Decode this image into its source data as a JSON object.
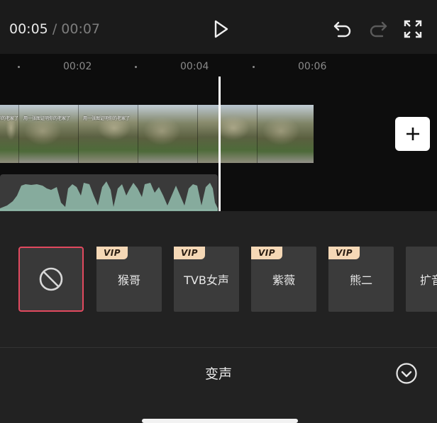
{
  "playback": {
    "current_time": "00:05",
    "separator": "/",
    "total_time": "00:07"
  },
  "timeline": {
    "ticks": [
      "00:02",
      "00:04",
      "00:06"
    ],
    "video_caption": "用一张图证明你的老家了"
  },
  "voice_effects": {
    "items": [
      {
        "label": "",
        "vip": false,
        "selected": true,
        "icon": "none-icon"
      },
      {
        "label": "猴哥",
        "vip": true
      },
      {
        "label": "TVB女声",
        "vip": true
      },
      {
        "label": "紫薇",
        "vip": true
      },
      {
        "label": "熊二",
        "vip": true
      },
      {
        "label": "扩音",
        "vip": false
      }
    ],
    "vip_badge": "VIP"
  },
  "panel": {
    "title": "变声"
  },
  "colors": {
    "accent_selected": "#e2495f",
    "vip_badge_bg": "#f5d8b6",
    "waveform": "#8fb8a8"
  }
}
